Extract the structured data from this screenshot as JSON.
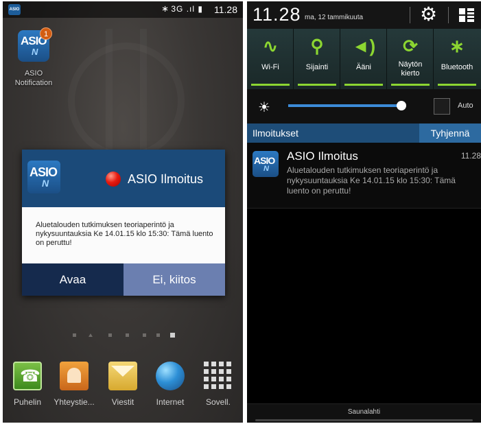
{
  "left_screen": {
    "status_bar": {
      "network": "3G",
      "time": "11.28"
    },
    "app": {
      "icon_line1": "ASIO",
      "icon_line2": "N",
      "badge_count": "1",
      "name_line1": "ASIO",
      "name_line2": "Notification"
    },
    "dialog": {
      "logo_line1": "ASIO",
      "logo_line2": "N",
      "title": "ASIO Ilmoitus",
      "message": "Aluetalouden tutkimuksen teoriaperintö ja nykysuuntauksia Ke 14.01.15 klo 15:30: Tämä luento on peruttu!",
      "open_button": "Avaa",
      "dismiss_button": "Ei, kiitos"
    },
    "page_indicator": {
      "count": 7,
      "active_index": 6
    },
    "dock": [
      {
        "label": "Puhelin",
        "icon": "phone-icon"
      },
      {
        "label": "Yhteystie...",
        "icon": "contacts-icon"
      },
      {
        "label": "Viestit",
        "icon": "messages-icon"
      },
      {
        "label": "Internet",
        "icon": "internet-globe-icon"
      },
      {
        "label": "Sovell.",
        "icon": "apps-grid-icon"
      }
    ]
  },
  "right_screen": {
    "header": {
      "time": "11.28",
      "date": "ma, 12 tammikuuta"
    },
    "quick_toggles": [
      {
        "label": "Wi-Fi",
        "icon": "wifi-icon"
      },
      {
        "label": "Sijainti",
        "icon": "location-icon"
      },
      {
        "label": "Ääni",
        "icon": "sound-icon"
      },
      {
        "label": "Näytön\nkierto",
        "icon": "rotate-icon"
      },
      {
        "label": "Bluetooth",
        "icon": "bluetooth-icon"
      }
    ],
    "brightness": {
      "level": 0.97,
      "auto_label": "Auto"
    },
    "notifications_header": {
      "title": "Ilmoitukset",
      "clear_button": "Tyhjennä"
    },
    "notification": {
      "logo_line1": "ASIO",
      "logo_line2": "N",
      "title": "ASIO Ilmoitus",
      "time": "11.28",
      "text": "Aluetalouden tutkimuksen teoriaperintö ja nykysuuntauksia Ke 14.01.15 klo 15:30: Tämä luento on peruttu!"
    },
    "carrier": "Saunalahti"
  },
  "colors": {
    "dialog_header": "#1b4a79",
    "open_button": "#152a4d",
    "dismiss_button": "#6b7fb0",
    "toggle_accent": "#8cd631",
    "notification_bar": "#1e4d78",
    "clear_button": "#2d6aa0",
    "brightness_track": "#3c8bd8"
  }
}
